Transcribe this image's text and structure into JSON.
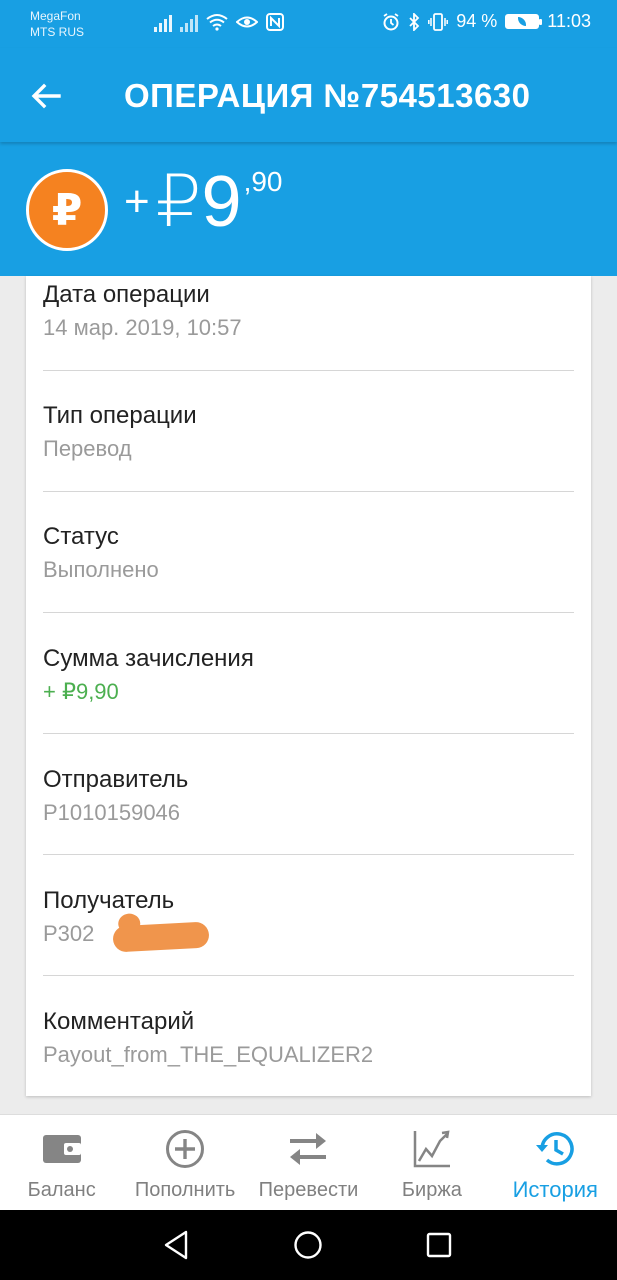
{
  "status_bar": {
    "carrier_1": "MegaFon",
    "carrier_2": "MTS RUS",
    "battery_percent": "94 %",
    "time": "11:03"
  },
  "header": {
    "title": "ОПЕРАЦИЯ №754513630",
    "back_icon": "arrow-left-icon"
  },
  "amount": {
    "sign": "+",
    "currency": "₽",
    "integer": "9",
    "fraction": ",90",
    "coin_symbol": "₽",
    "coin_color": "#f58220"
  },
  "details": [
    {
      "label": "Дата операции",
      "value": "14 мар. 2019, 10:57"
    },
    {
      "label": "Тип операции",
      "value": "Перевод"
    },
    {
      "label": "Статус",
      "value": "Выполнено"
    },
    {
      "label": "Сумма зачисления",
      "value": "+ ₽9,90"
    },
    {
      "label": "Отправитель",
      "value": "P1010159046"
    },
    {
      "label": "Получатель",
      "value": "P302"
    },
    {
      "label": "Комментарий",
      "value": "Payout_from_THE_EQUALIZER2"
    }
  ],
  "bottom_nav": [
    {
      "label": "Баланс",
      "icon": "wallet-icon"
    },
    {
      "label": "Пополнить",
      "icon": "plus-circle-icon"
    },
    {
      "label": "Перевести",
      "icon": "transfer-arrows-icon"
    },
    {
      "label": "Биржа",
      "icon": "chart-icon"
    },
    {
      "label": "История",
      "icon": "history-icon",
      "active": true
    }
  ],
  "colors": {
    "primary": "#189fe3",
    "accent_green": "#4caf50",
    "muted_text": "#9a9a9a"
  }
}
